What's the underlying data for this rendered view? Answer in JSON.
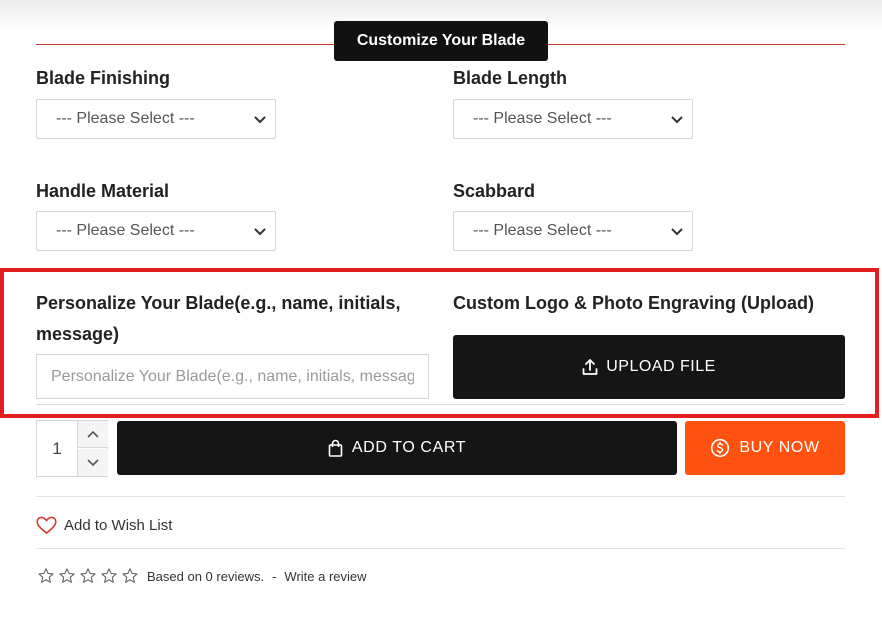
{
  "section_title": "Customize Your Blade",
  "options": {
    "blade_finishing": {
      "label": "Blade Finishing",
      "value": "--- Please Select ---"
    },
    "blade_length": {
      "label": "Blade Length",
      "value": "--- Please Select ---"
    },
    "handle_material": {
      "label": "Handle Material",
      "value": "--- Please Select ---"
    },
    "scabbard": {
      "label": "Scabbard",
      "value": "--- Please Select ---"
    }
  },
  "personalize": {
    "label_line1": "Personalize Your Blade(e.g., name, initials,",
    "label_line2": "message)",
    "placeholder": "Personalize Your Blade(e.g., name, initials, message)"
  },
  "engraving": {
    "label": "Custom Logo & Photo Engraving (Upload)",
    "button_label": "UPLOAD FILE",
    "icon": "upload-icon"
  },
  "purchase": {
    "quantity": "1",
    "add_to_cart_label": "ADD TO CART",
    "buy_now_label": "BUY NOW",
    "colors": {
      "buy_now": "#ff5210",
      "dark": "#151515",
      "highlight": "#e41e1e"
    }
  },
  "wishlist": {
    "label": "Add to Wish List",
    "icon": "heart-icon"
  },
  "reviews": {
    "rating": 0,
    "max_rating": 5,
    "summary": "Based on 0 reviews.",
    "separator": "-",
    "write_review_label": "Write a review"
  }
}
